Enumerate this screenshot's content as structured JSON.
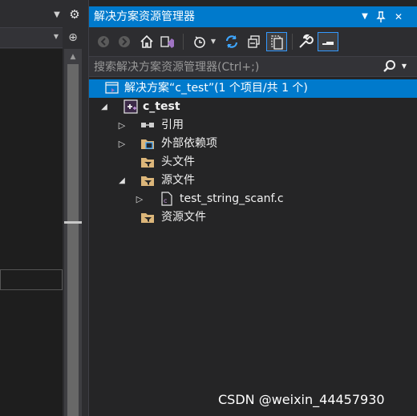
{
  "left_pane": {
    "dropdown_icon": "▼",
    "gear_icon": "⚙",
    "split_icon": "⊕"
  },
  "solution_explorer": {
    "title": "解决方案资源管理器",
    "title_buttons": {
      "dropdown": "▼",
      "pin": "📌",
      "close": "✕"
    },
    "search": {
      "placeholder": "搜索解决方案资源管理器(Ctrl+;)"
    },
    "tree": {
      "solution": "解决方案“c_test”(1 个项目/共 1 个)",
      "project": "c_test",
      "references": "引用",
      "external_deps": "外部依赖项",
      "header_files": "头文件",
      "source_files": "源文件",
      "source_file_1": "test_string_scanf.c",
      "resource_files": "资源文件"
    }
  },
  "colors": {
    "accent": "#007acc",
    "panel_bg": "#252526",
    "folder": "#dcb67a",
    "vs_purple": "#68217a"
  },
  "watermark": "CSDN @weixin_44457930"
}
